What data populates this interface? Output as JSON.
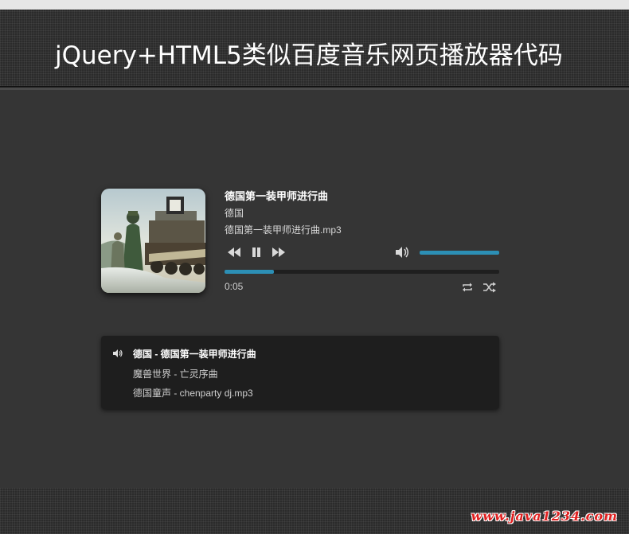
{
  "page": {
    "title": "jQuery+HTML5类似百度音乐网页播放器代码"
  },
  "player": {
    "track_title": "德国第一装甲师进行曲",
    "artist": "德国",
    "file": "德国第一装甲师进行曲.mp3",
    "current_time": "0:05",
    "progress_fraction": 0.18,
    "volume_fraction": 1.0,
    "accent_color": "#2c8fb5",
    "icons": {
      "prev": "rewind-icon",
      "pause": "pause-icon",
      "next": "fast-forward-icon",
      "volume": "volume-icon",
      "repeat": "repeat-icon",
      "shuffle": "shuffle-icon"
    }
  },
  "playlist": {
    "items": [
      {
        "label": "德国 - 德国第一装甲师进行曲",
        "active": true
      },
      {
        "label": "魔兽世界 - 亡灵序曲",
        "active": false
      },
      {
        "label": "德国童声 - chenparty dj.mp3",
        "active": false
      }
    ]
  },
  "footer": {
    "watermark": "www.java1234.com"
  }
}
